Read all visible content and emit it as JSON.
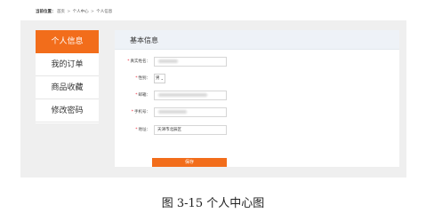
{
  "breadcrumb": {
    "label": "当前位置：",
    "items": [
      "首页",
      "个人中心",
      "个人信息"
    ],
    "separator": ">"
  },
  "sidebar": {
    "items": [
      {
        "label": "个人信息",
        "active": true
      },
      {
        "label": "我的订单",
        "active": false
      },
      {
        "label": "商品收藏",
        "active": false
      },
      {
        "label": "修改密码",
        "active": false
      }
    ]
  },
  "panel": {
    "title": "基本信息",
    "required_mark": "*",
    "fields": {
      "real_name": {
        "label": "真实姓名：",
        "value": ""
      },
      "gender": {
        "label": "性别：",
        "value": "男"
      },
      "email": {
        "label": "邮箱：",
        "value": ""
      },
      "phone": {
        "label": "手机号：",
        "value": ""
      },
      "address": {
        "label": "地址：",
        "value": "天津市北辰区"
      }
    },
    "save_label": "保存"
  },
  "caption": "图 3-15  个人中心图",
  "colors": {
    "accent": "#f26d1b",
    "panel_header": "#eef2f7",
    "stage_bg": "#efefef",
    "required": "#e23"
  }
}
